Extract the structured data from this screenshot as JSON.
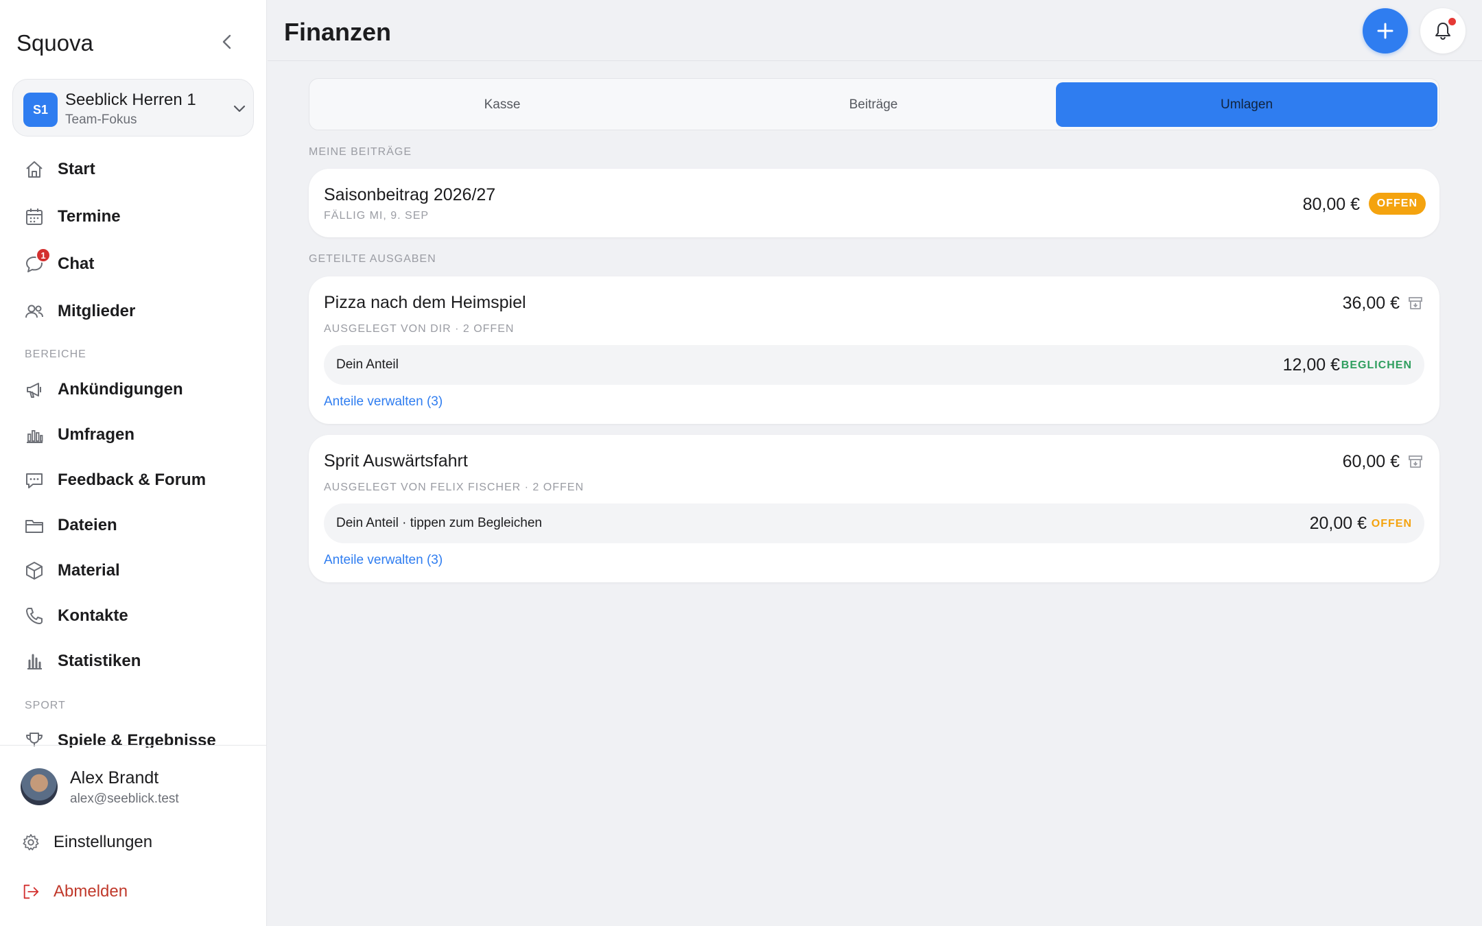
{
  "app": {
    "brand": "Squova"
  },
  "team": {
    "badge": "S1",
    "name": "Seeblick Herren 1",
    "sub": "Team-Fokus"
  },
  "nav": {
    "items": [
      {
        "label": "Start"
      },
      {
        "label": "Termine"
      },
      {
        "label": "Chat",
        "badge": "1"
      },
      {
        "label": "Mitglieder"
      }
    ],
    "section_bereiche": "BEREICHE",
    "bereiche": [
      {
        "label": "Ankündigungen"
      },
      {
        "label": "Umfragen"
      },
      {
        "label": "Feedback & Forum"
      },
      {
        "label": "Dateien"
      },
      {
        "label": "Material"
      },
      {
        "label": "Kontakte"
      },
      {
        "label": "Statistiken"
      }
    ],
    "section_sport": "SPORT",
    "sport": [
      {
        "label": "Spiele & Ergebnisse"
      }
    ]
  },
  "user": {
    "name": "Alex Brandt",
    "email": "alex@seeblick.test"
  },
  "bottom": {
    "settings": "Einstellungen",
    "logout": "Abmelden"
  },
  "header": {
    "title": "Finanzen"
  },
  "tabs": [
    {
      "label": "Kasse"
    },
    {
      "label": "Beiträge"
    },
    {
      "label": "Umlagen"
    }
  ],
  "meine": {
    "label": "MEINE BEITRÄGE",
    "title": "Saisonbeitrag 2026/27",
    "due": "FÄLLIG MI, 9. SEP",
    "amount": "80,00 €",
    "status": "OFFEN"
  },
  "geteilt": {
    "label": "GETEILTE AUSGABEN",
    "items": [
      {
        "title": "Pizza nach dem Heimspiel",
        "amount": "36,00 €",
        "sub": "AUSGELEGT VON DIR · 2 OFFEN",
        "share_label": "Dein Anteil",
        "share_amount": "12,00 €",
        "share_status": "BEGLICHEN",
        "link": "Anteile verwalten (3)"
      },
      {
        "title": "Sprit Auswärtsfahrt",
        "amount": "60,00 €",
        "sub": "AUSGELEGT VON FELIX FISCHER · 2 OFFEN",
        "share_label": "Dein Anteil · tippen zum Begleichen",
        "share_amount": "20,00 €",
        "share_status": "OFFEN",
        "link": "Anteile verwalten (3)"
      }
    ]
  },
  "colors": {
    "accent": "#2f7df0",
    "warning": "#f4a30f",
    "success": "#2e9e5e",
    "danger": "#d3302f"
  }
}
